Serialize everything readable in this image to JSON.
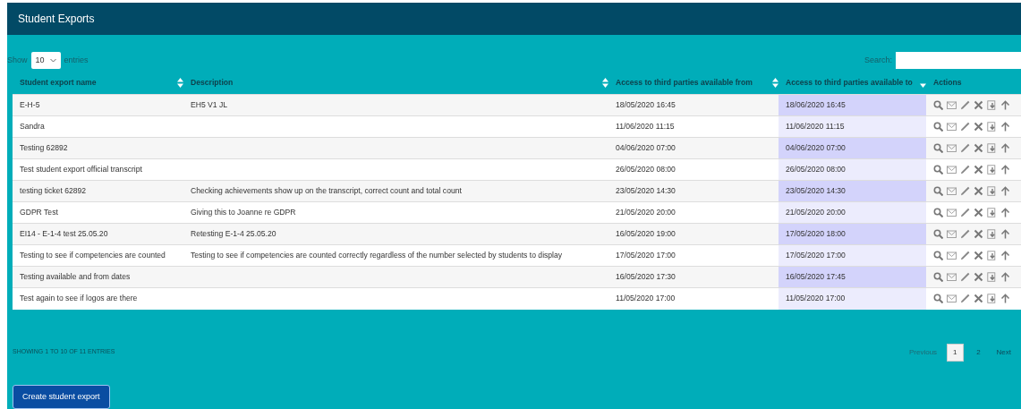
{
  "panel": {
    "title": "Student Exports"
  },
  "length_control": {
    "before": "Show",
    "value": "10",
    "after": "entries"
  },
  "search": {
    "label": "Search:"
  },
  "table": {
    "columns": [
      {
        "label": "Student export name",
        "sortable": true,
        "sorted": false
      },
      {
        "label": "Description",
        "sortable": true,
        "sorted": false
      },
      {
        "label": "Access to third parties available from",
        "sortable": true,
        "sorted": false
      },
      {
        "label": "Access to third parties available to",
        "sortable": true,
        "sorted": true
      },
      {
        "label": "Actions",
        "sortable": false
      }
    ],
    "rows": [
      {
        "name": "E-H-5",
        "description": "EH5 V1 JL",
        "from": "18/05/2020 16:45",
        "to": "18/06/2020 16:45"
      },
      {
        "name": "Sandra",
        "description": "",
        "from": "11/06/2020 11:15",
        "to": "11/06/2020 11:15"
      },
      {
        "name": "Testing 62892",
        "description": "",
        "from": "04/06/2020 07:00",
        "to": "04/06/2020 07:00"
      },
      {
        "name": "Test student export official transcript",
        "description": "",
        "from": "26/05/2020 08:00",
        "to": "26/05/2020 08:00"
      },
      {
        "name": "testing ticket 62892",
        "description": "Checking achievements show up on the transcript, correct count and total count",
        "from": "23/05/2020 14:30",
        "to": "23/05/2020 14:30"
      },
      {
        "name": "GDPR Test",
        "description": "Giving this to Joanne re GDPR",
        "from": "21/05/2020 20:00",
        "to": "21/05/2020 20:00"
      },
      {
        "name": "EI14 - E-1-4 test 25.05.20",
        "description": "Retesting E-1-4 25.05.20",
        "from": "16/05/2020 19:00",
        "to": "17/05/2020 18:00"
      },
      {
        "name": "Testing to see if competencies are counted",
        "description": "Testing to see if competencies are counted correctly regardless of the number selected by students to display",
        "from": "17/05/2020 17:00",
        "to": "17/05/2020 17:00"
      },
      {
        "name": "Testing available and from dates",
        "description": "",
        "from": "16/05/2020 17:30",
        "to": "16/05/2020 17:45"
      },
      {
        "name": "Test again to see if logos are there",
        "description": "",
        "from": "11/05/2020 17:00",
        "to": "11/05/2020 17:00"
      }
    ]
  },
  "info": "SHOWING 1 TO 10 OF 11 ENTRIES",
  "pagination": [
    {
      "label": "Previous",
      "kind": "nav",
      "disabled": true,
      "selected": false
    },
    {
      "label": "1",
      "kind": "page",
      "disabled": false,
      "selected": true
    },
    {
      "label": "2",
      "kind": "page",
      "disabled": false,
      "selected": false
    },
    {
      "label": "Next",
      "kind": "nav",
      "disabled": false,
      "selected": false
    }
  ],
  "create_button": "Create student export"
}
